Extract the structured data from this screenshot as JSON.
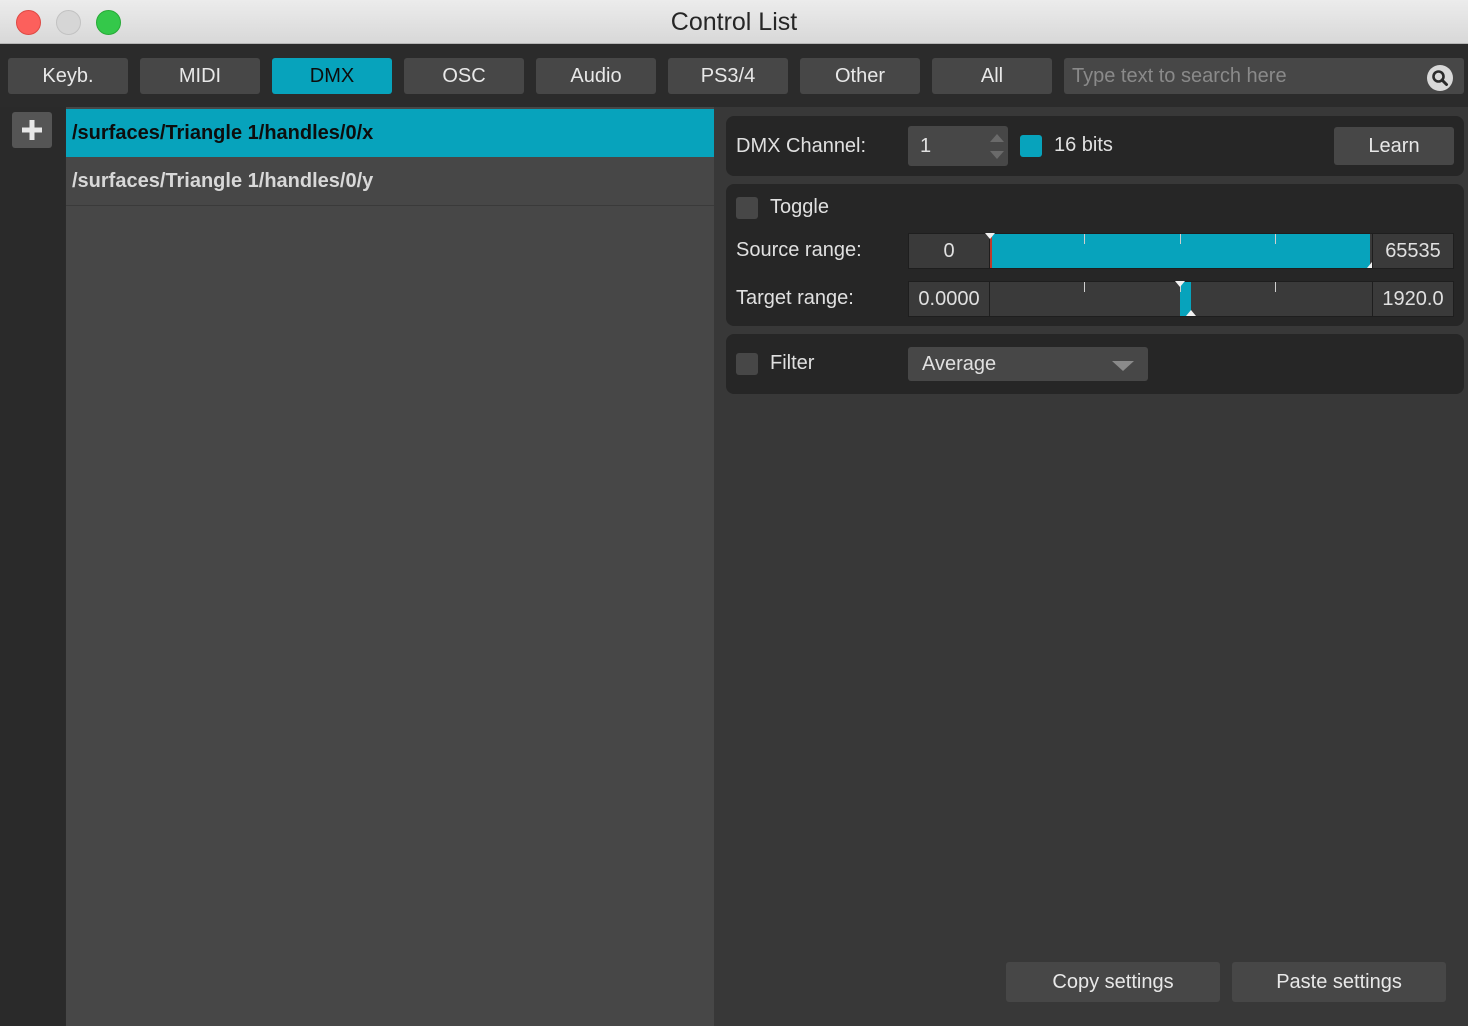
{
  "window": {
    "title": "Control List"
  },
  "tabs": [
    {
      "label": "Keyb."
    },
    {
      "label": "MIDI"
    },
    {
      "label": "DMX",
      "active": true
    },
    {
      "label": "OSC"
    },
    {
      "label": "Audio"
    },
    {
      "label": "PS3/4"
    },
    {
      "label": "Other"
    },
    {
      "label": "All"
    }
  ],
  "search": {
    "placeholder": "Type text to search here",
    "value": "",
    "icon": "search-icon"
  },
  "add_button": {
    "icon": "plus-icon"
  },
  "controls": [
    {
      "path": "/surfaces/Triangle 1/handles/0/x",
      "selected": true
    },
    {
      "path": "/surfaces/Triangle 1/handles/0/y",
      "selected": false
    }
  ],
  "dmx": {
    "channel_label": "DMX Channel:",
    "channel_value": "1",
    "bits16_label": "16 bits",
    "bits16_checked": true,
    "learn_label": "Learn"
  },
  "mapping": {
    "toggle_label": "Toggle",
    "toggle_checked": false,
    "source_label": "Source range:",
    "source_min": "0",
    "source_max": "65535",
    "source_fill": [
      0.0,
      1.0
    ],
    "target_label": "Target range:",
    "target_min": "0.0000",
    "target_max": "1920.0",
    "target_fill": [
      0.5,
      0.53
    ]
  },
  "filter": {
    "label": "Filter",
    "checked": false,
    "selected": "Average"
  },
  "footer": {
    "copy_label": "Copy settings",
    "paste_label": "Paste settings"
  },
  "colors": {
    "accent": "#07a3bc",
    "panel": "#262626",
    "button": "#474747"
  }
}
